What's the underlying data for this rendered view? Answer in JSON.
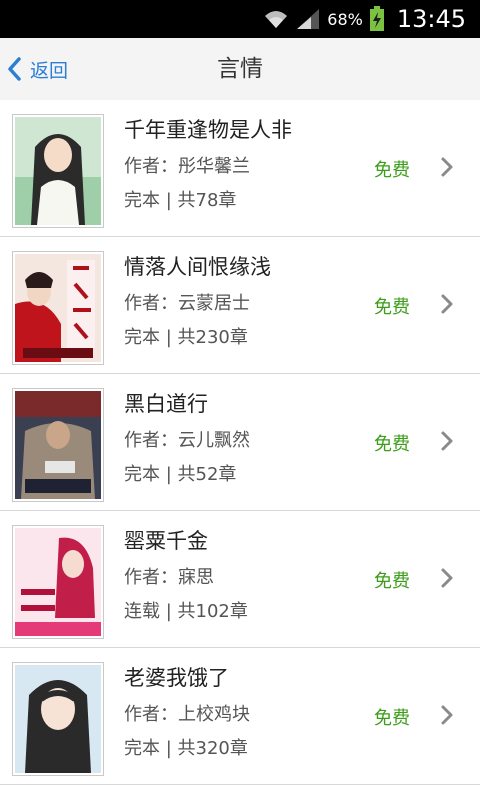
{
  "status_bar": {
    "battery_percent": "68%",
    "time": "13:45",
    "icons": [
      "wifi-icon",
      "signal-icon",
      "battery-charging-icon"
    ]
  },
  "header": {
    "back_label": "返回",
    "title": "言情"
  },
  "colors": {
    "accent": "#2a7fd4",
    "free_label": "#3c9d1a",
    "header_bg": "#f4f4f4"
  },
  "books": [
    {
      "title": "千年重逢物是人非",
      "author": "作者：彤华馨兰",
      "status": "完本 | 共78章",
      "price": "免费",
      "cover": "book-cover-1"
    },
    {
      "title": "情落人间恨缘浅",
      "author": "作者：云蒙居士",
      "status": "完本 | 共230章",
      "price": "免费",
      "cover": "book-cover-2"
    },
    {
      "title": "黑白道行",
      "author": "作者：云儿飘然",
      "status": "完本 | 共52章",
      "price": "免费",
      "cover": "book-cover-3"
    },
    {
      "title": "罂粟千金",
      "author": "作者：寐思",
      "status": "连载 | 共102章",
      "price": "免费",
      "cover": "book-cover-4"
    },
    {
      "title": "老婆我饿了",
      "author": "作者：上校鸡块",
      "status": "完本 | 共320章",
      "price": "免费",
      "cover": "book-cover-5"
    }
  ]
}
